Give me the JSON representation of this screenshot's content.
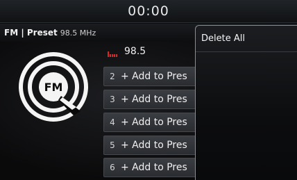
{
  "status_bar": {
    "clock": "00:00"
  },
  "mode_bar": {
    "label": "FM | Preset",
    "frequency": "98.5 MHz"
  },
  "logo": {
    "text": "FM"
  },
  "presets": {
    "current": {
      "frequency": "98.5"
    },
    "items": [
      {
        "number": "2",
        "label": "+ Add to Pres"
      },
      {
        "number": "3",
        "label": "+ Add to Pres"
      },
      {
        "number": "4",
        "label": "+ Add to Pres"
      },
      {
        "number": "5",
        "label": "+ Add to Pres"
      },
      {
        "number": "6",
        "label": "+ Add to Pres"
      }
    ]
  },
  "menu": {
    "delete_all": "Delete All"
  },
  "colors": {
    "accent_red": "#d42a2a",
    "background": "#0a0a0a"
  }
}
